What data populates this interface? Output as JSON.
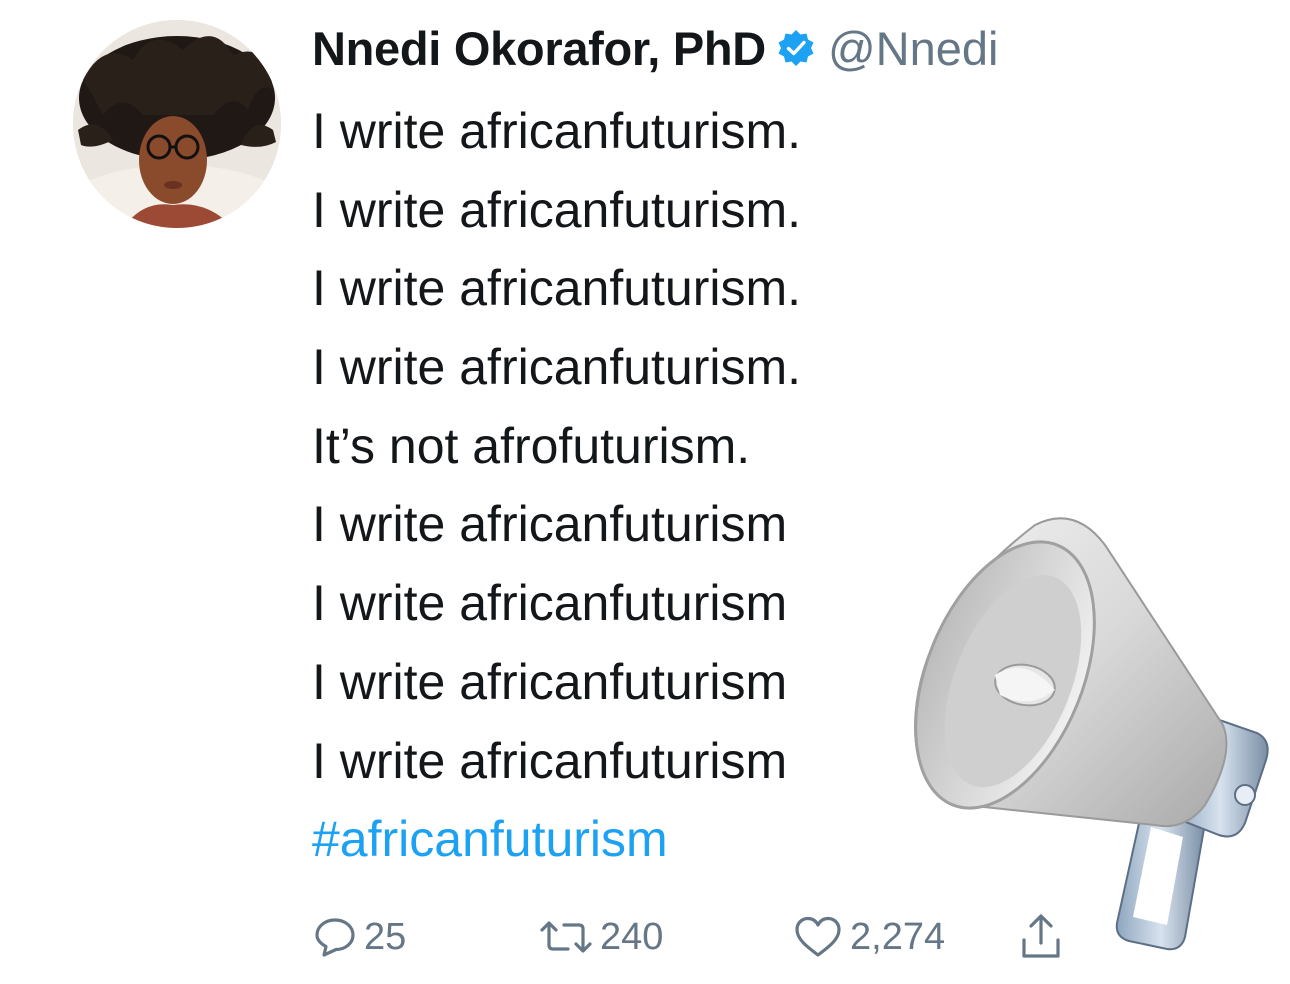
{
  "tweet": {
    "author": {
      "display_name": "Nnedi Okorafor, PhD",
      "handle": "@Nnedi",
      "verified": true,
      "avatar_icon": "profile-photo"
    },
    "lines": [
      "I write africanfuturism.",
      "I write africanfuturism.",
      "I write africanfuturism.",
      "I write africanfuturism.",
      "It’s not afrofuturism.",
      "I write africanfuturism",
      "I write africanfuturism",
      "I write africanfuturism",
      "I write africanfuturism"
    ],
    "hashtag": "#africanfuturism",
    "actions": {
      "reply_count": "25",
      "retweet_count": "240",
      "like_count": "2,274"
    },
    "sticker": "megaphone-emoji"
  },
  "colors": {
    "text": "#14171a",
    "secondary": "#657786",
    "link": "#1da1f2",
    "verified": "#1da1f2"
  }
}
